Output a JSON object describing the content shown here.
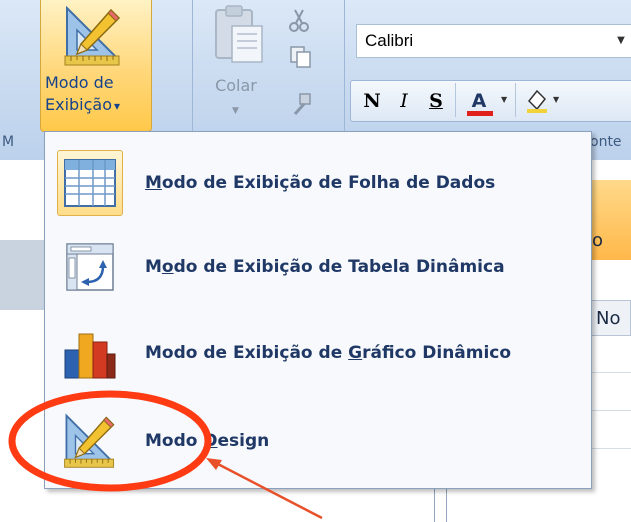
{
  "ribbon": {
    "views_button": {
      "line1": "Modo de",
      "line2": "Exibição",
      "dropdown_glyph": "▾",
      "icon": "design-ruler-pencil-icon"
    },
    "clipboard": {
      "paste_label": "Colar",
      "paste_icon": "paste-icon",
      "cut_icon": "scissors-icon",
      "copy_icon": "copy-icon",
      "format_painter_icon": "format-painter-icon"
    },
    "font": {
      "name": "Calibri",
      "bold": "N",
      "italic": "I",
      "underline": "S",
      "font_color": "A",
      "font_color_bar": "#e0201b"
    },
    "bottom_fragments": {
      "left": "M",
      "right": "onte"
    }
  },
  "menu": {
    "items": [
      {
        "before": "",
        "underlined": "M",
        "after": "odo de Exibição de Folha de Dados",
        "icon": "datasheet-grid-icon"
      },
      {
        "before": "M",
        "underlined": "o",
        "after": "do de Exibição de Tabela Dinâmica",
        "icon": "pivot-table-icon"
      },
      {
        "before": "Modo de Exibição de ",
        "underlined": "G",
        "after": "ráfico Dinâmico",
        "icon": "pivot-chart-icon"
      },
      {
        "before": "Modo ",
        "underlined": "D",
        "after": "esign",
        "icon": "design-ruler-pencil-icon"
      }
    ]
  },
  "background": {
    "tab_fragment": "o",
    "column_fragment": "No"
  },
  "annotation": {
    "oval_color": "#ff3b14",
    "arrow_color": "#e8502a"
  }
}
